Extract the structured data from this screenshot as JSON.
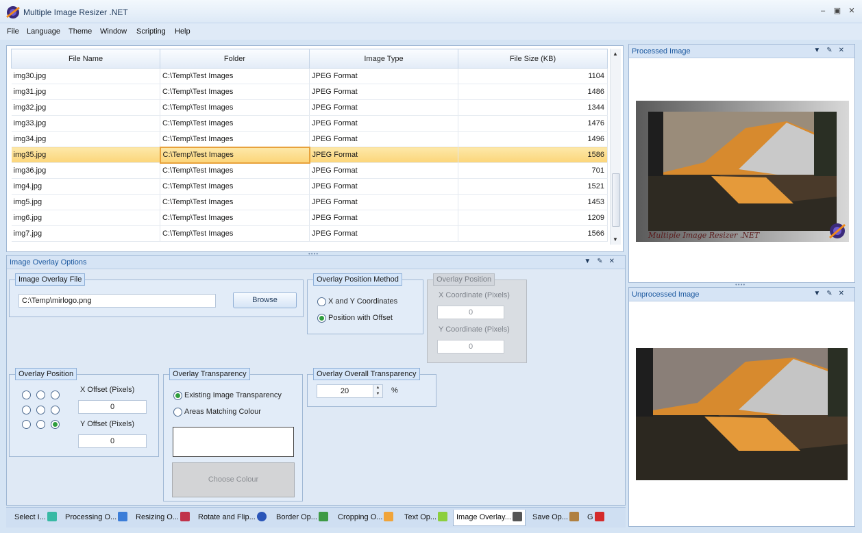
{
  "window": {
    "title": "Multiple Image Resizer .NET"
  },
  "menu": [
    "File",
    "Language",
    "Theme",
    "Window",
    "Scripting",
    "Help"
  ],
  "grid": {
    "columns": [
      "File Name",
      "Folder",
      "Image Type",
      "File Size (KB)"
    ],
    "rows": [
      [
        "img30.jpg",
        "C:\\Temp\\Test Images",
        "JPEG Format",
        "1104"
      ],
      [
        "img31.jpg",
        "C:\\Temp\\Test Images",
        "JPEG Format",
        "1486"
      ],
      [
        "img32.jpg",
        "C:\\Temp\\Test Images",
        "JPEG Format",
        "1344"
      ],
      [
        "img33.jpg",
        "C:\\Temp\\Test Images",
        "JPEG Format",
        "1476"
      ],
      [
        "img34.jpg",
        "C:\\Temp\\Test Images",
        "JPEG Format",
        "1496"
      ],
      [
        "img35.jpg",
        "C:\\Temp\\Test Images",
        "JPEG Format",
        "1586"
      ],
      [
        "img36.jpg",
        "C:\\Temp\\Test Images",
        "JPEG Format",
        "701"
      ],
      [
        "img4.jpg",
        "C:\\Temp\\Test Images",
        "JPEG Format",
        "1521"
      ],
      [
        "img5.jpg",
        "C:\\Temp\\Test Images",
        "JPEG Format",
        "1453"
      ],
      [
        "img6.jpg",
        "C:\\Temp\\Test Images",
        "JPEG Format",
        "1209"
      ],
      [
        "img7.jpg",
        "C:\\Temp\\Test Images",
        "JPEG Format",
        "1566"
      ]
    ],
    "selected_row": 5
  },
  "overlay_panel": {
    "title": "Image Overlay Options",
    "file_group": {
      "label": "Image Overlay File",
      "path": "C:\\Temp\\mirlogo.png",
      "browse": "Browse"
    },
    "method_group": {
      "label": "Overlay Position Method",
      "options": [
        "X and Y Coordinates",
        "Position with Offset"
      ],
      "selected": 1
    },
    "position_group": {
      "label": "Overlay Position",
      "x_coord_label": "X Coordinate (Pixels)",
      "x_coord": "0",
      "y_coord_label": "Y Coordinate (Pixels)",
      "y_coord": "0"
    },
    "offset_group": {
      "label": "Overlay Position",
      "x_offset_label": "X Offset (Pixels)",
      "x_offset": "0",
      "y_offset_label": "Y Offset (Pixels)",
      "y_offset": "0",
      "anchor_selected": "bottom-right"
    },
    "transparency_group": {
      "label": "Overlay Transparency",
      "options": [
        "Existing Image Transparency",
        "Areas Matching Colour"
      ],
      "selected": 0,
      "choose_colour": "Choose Colour"
    },
    "overall_group": {
      "label": "Overlay Overall Transparency",
      "value": "20",
      "unit": "%"
    }
  },
  "tabs": [
    "Select I...",
    "Processing O...",
    "Resizing O...",
    "Rotate and Flip...",
    "Border Op...",
    "Cropping O...",
    "Text Op...",
    "Image Overlay...",
    "Save Op...",
    "G"
  ],
  "active_tab": 7,
  "processed_panel": {
    "title": "Processed Image",
    "watermark": "Multiple Image Resizer .NET"
  },
  "unprocessed_panel": {
    "title": "Unprocessed Image"
  },
  "colors": {
    "accent": "#1e5aa0",
    "selection": "#fcd57a",
    "radio_checked": "#2f9e3e"
  }
}
